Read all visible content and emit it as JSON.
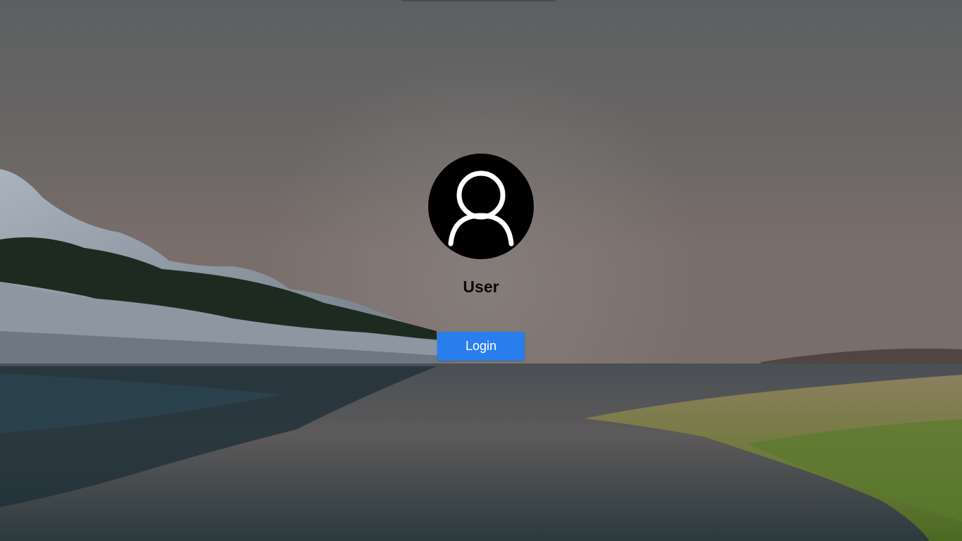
{
  "login": {
    "username": "User",
    "button_label": "Login"
  },
  "icons": {
    "avatar": "user-silhouette-icon"
  },
  "colors": {
    "button": "#2a7ded",
    "avatar_bg": "#000000",
    "username_text": "#0a0a0a"
  }
}
